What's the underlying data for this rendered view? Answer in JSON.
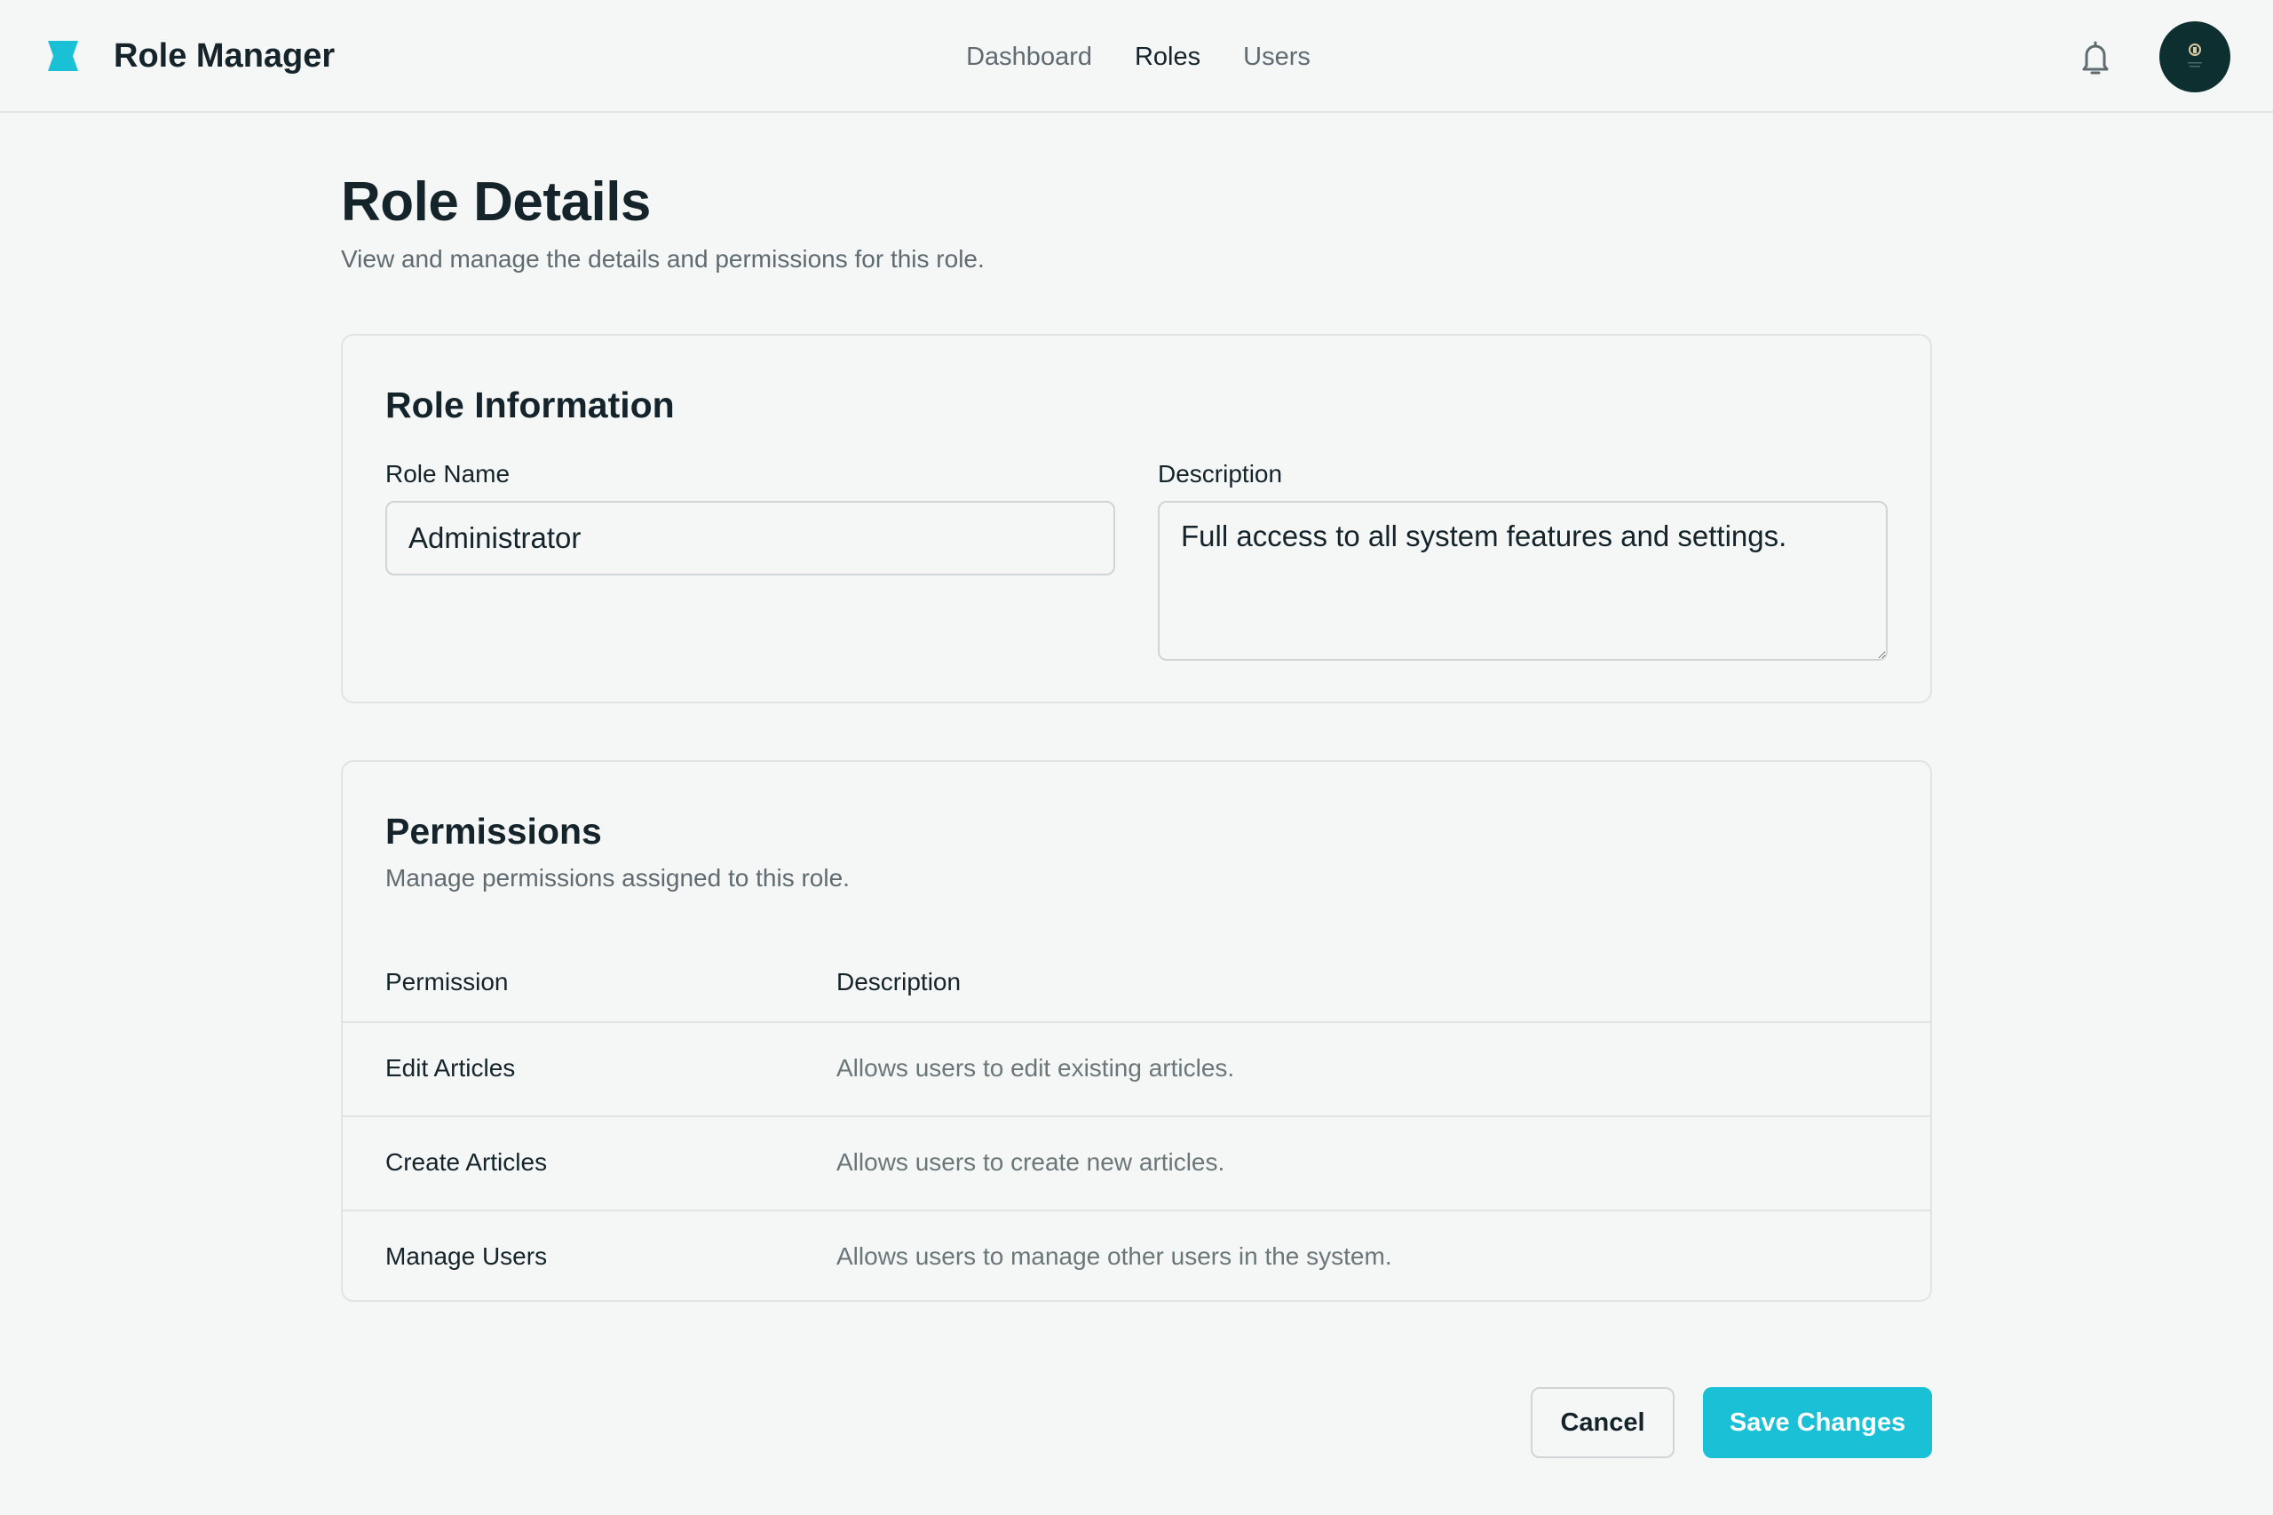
{
  "header": {
    "app_title": "Role Manager",
    "logo_icon": "bookmark-logo-icon",
    "nav": [
      {
        "label": "Dashboard",
        "active": false
      },
      {
        "label": "Roles",
        "active": true
      },
      {
        "label": "Users",
        "active": false
      }
    ],
    "notification_icon": "bell-icon",
    "avatar_icon": "user-avatar"
  },
  "page": {
    "title": "Role Details",
    "subtitle": "View and manage the details and permissions for this role."
  },
  "role_info": {
    "heading": "Role Information",
    "name_label": "Role Name",
    "name_value": "Administrator",
    "description_label": "Description",
    "description_value": "Full access to all system features and settings."
  },
  "permissions": {
    "heading": "Permissions",
    "subtitle": "Manage permissions assigned to this role.",
    "columns": [
      "Permission",
      "Description"
    ],
    "rows": [
      {
        "name": "Edit Articles",
        "description": "Allows users to edit existing articles."
      },
      {
        "name": "Create Articles",
        "description": "Allows users to create new articles."
      },
      {
        "name": "Manage Users",
        "description": "Allows users to manage other users in the system."
      }
    ]
  },
  "actions": {
    "cancel_label": "Cancel",
    "save_label": "Save Changes"
  },
  "colors": {
    "accent": "#19c0d6",
    "text_primary": "#14242a",
    "text_secondary": "#5f6b70",
    "background": "#f5f7f6",
    "avatar_bg": "#0d2f30"
  }
}
